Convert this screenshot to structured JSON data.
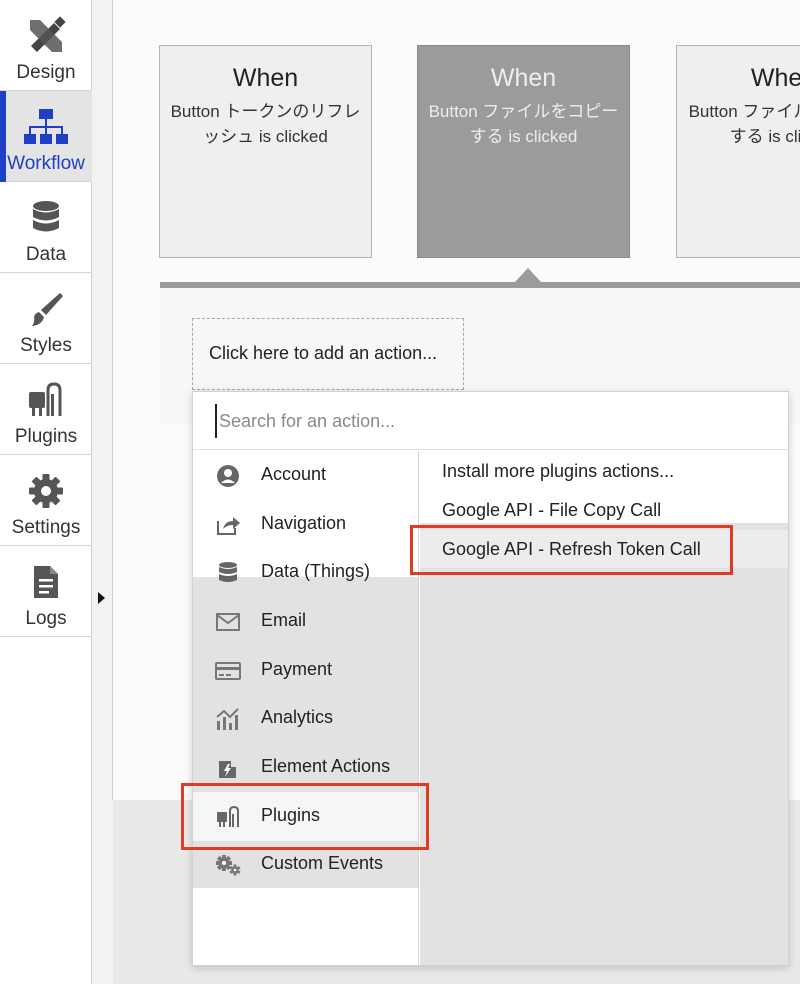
{
  "nav": {
    "items": [
      {
        "label": "Design",
        "icon": "design-icon"
      },
      {
        "label": "Workflow",
        "icon": "workflow-icon"
      },
      {
        "label": "Data",
        "icon": "database-icon"
      },
      {
        "label": "Styles",
        "icon": "brush-icon"
      },
      {
        "label": "Plugins",
        "icon": "plugin-icon"
      },
      {
        "label": "Settings",
        "icon": "gear-icon"
      },
      {
        "label": "Logs",
        "icon": "document-icon"
      }
    ],
    "active": "Workflow",
    "accent_color": "#1f3fc4"
  },
  "events": [
    {
      "when": "When",
      "desc": "Button トークンのリフレッシュ is clicked"
    },
    {
      "when": "When",
      "desc": "Button ファイルをコピーする is clicked"
    },
    {
      "when": "When",
      "desc": "Button ファイルをコピーする is clicked"
    }
  ],
  "panel": {
    "add_action_label": "Click here to add an action..."
  },
  "dropdown": {
    "search_placeholder": "Search for an action...",
    "categories": [
      {
        "label": "Account",
        "icon": "account-icon"
      },
      {
        "label": "Navigation",
        "icon": "navigation-icon"
      },
      {
        "label": "Data (Things)",
        "icon": "database-icon"
      },
      {
        "label": "Email",
        "icon": "email-icon"
      },
      {
        "label": "Payment",
        "icon": "payment-icon"
      },
      {
        "label": "Analytics",
        "icon": "analytics-icon"
      },
      {
        "label": "Element Actions",
        "icon": "element-actions-icon"
      },
      {
        "label": "Plugins",
        "icon": "plugin-icon"
      },
      {
        "label": "Custom Events",
        "icon": "custom-events-icon"
      }
    ],
    "selected_category": "Plugins",
    "actions": [
      "Install more plugins actions...",
      "Google API - File Copy Call",
      "Google API - Refresh Token Call"
    ],
    "highlight_color": "#e23b24"
  }
}
